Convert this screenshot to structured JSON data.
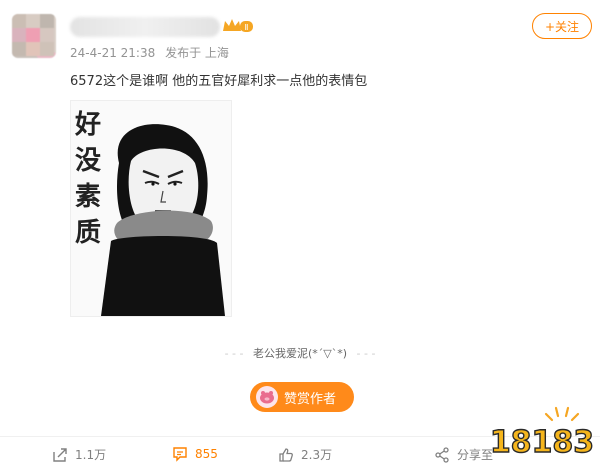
{
  "post": {
    "timestamp": "24-4-21 21:38",
    "source": "发布于 上海",
    "text": "6572这个是谁啊 他的五官好犀利求一点他的表情包",
    "meme_caption": [
      "好",
      "没",
      "素",
      "质"
    ]
  },
  "header": {
    "follow_label": "+关注",
    "badge_level": "Ⅱ"
  },
  "signature": {
    "text": "老公我爱泥(*´▽`*)"
  },
  "reward": {
    "label": "赞赏作者"
  },
  "actions": {
    "share_count": "1.1万",
    "comment_count": "855",
    "like_count": "2.3万",
    "forward_label": "分享至"
  },
  "watermark": {
    "text": "18183"
  },
  "colors": {
    "accent": "#ff8200",
    "reward_bg": "#ff8a1a",
    "meta_gray": "#939393"
  },
  "icons": [
    "share-icon",
    "comment-icon",
    "like-icon",
    "forward-icon",
    "crown-icon",
    "pig-icon"
  ]
}
